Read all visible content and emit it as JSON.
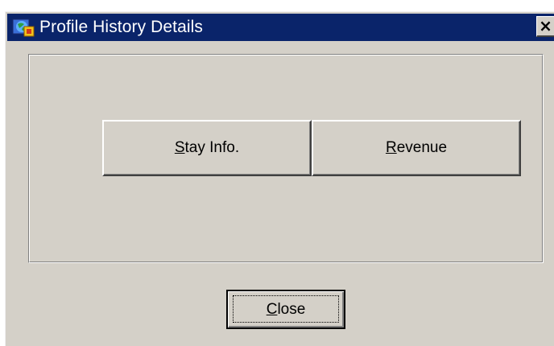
{
  "window": {
    "title": "Profile History Details",
    "close_glyph": "×",
    "icon": "app-globe-icon"
  },
  "panel": {
    "buttons": [
      {
        "label_mnemonic": "S",
        "label_rest": "tay Info."
      },
      {
        "label_mnemonic": "R",
        "label_rest": "evenue"
      }
    ]
  },
  "footer": {
    "close_mnemonic": "C",
    "close_rest": "lose"
  },
  "colors": {
    "titlebar": "#0a246a",
    "face": "#d4d0c8"
  }
}
